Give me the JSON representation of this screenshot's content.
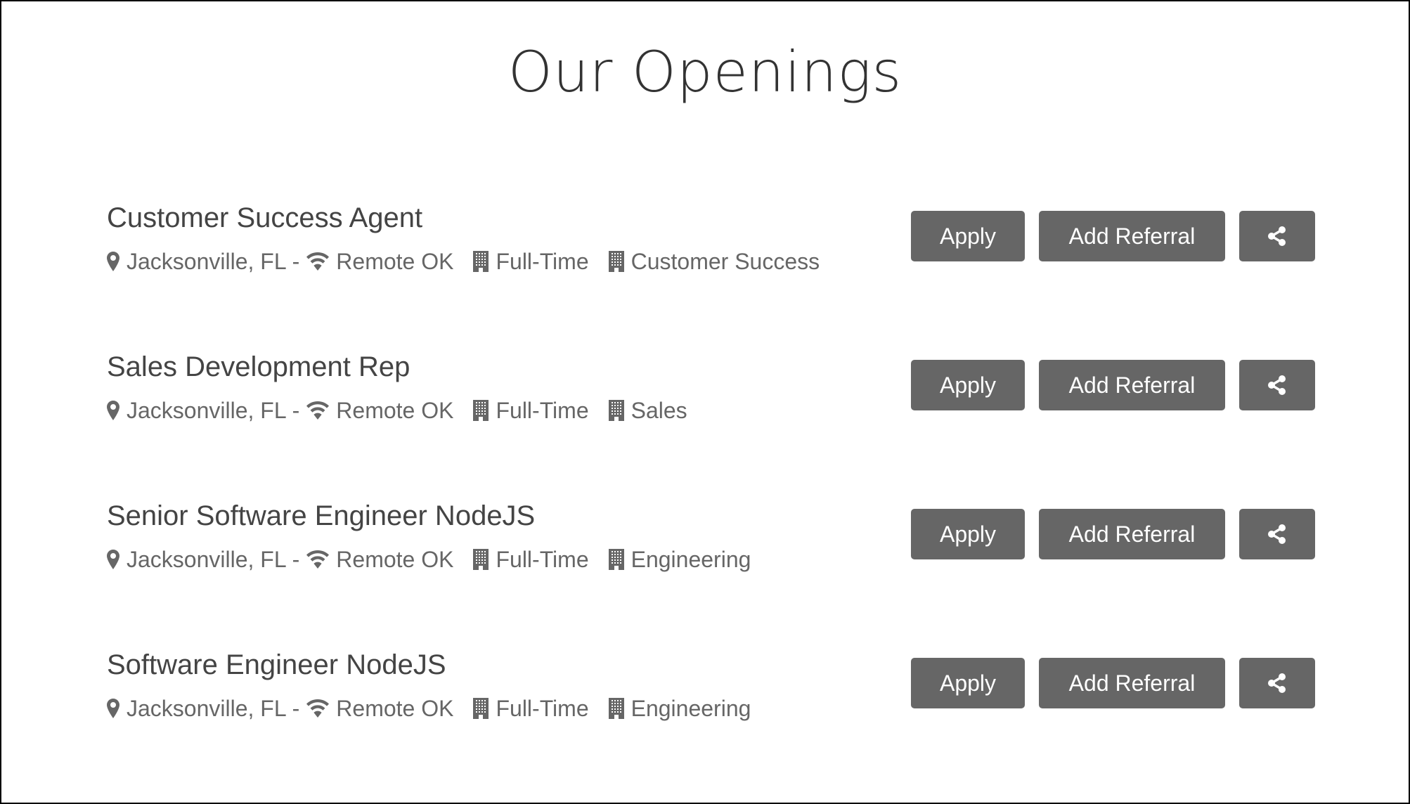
{
  "header": {
    "title": "Our Openings"
  },
  "buttons": {
    "apply_label": "Apply",
    "referral_label": "Add Referral",
    "share_icon": "share-icon"
  },
  "icons": {
    "location": "map-marker-icon",
    "remote": "wifi-icon",
    "type": "building-icon",
    "department": "building-icon"
  },
  "colors": {
    "button_bg": "#666666",
    "button_text": "#ffffff",
    "title_text": "#333333",
    "job_title_text": "#444444",
    "meta_text": "#666666"
  },
  "openings": [
    {
      "title": "Customer Success Agent",
      "location": "Jacksonville, FL",
      "separator": "-",
      "remote": "Remote OK",
      "type": "Full-Time",
      "department": "Customer Success"
    },
    {
      "title": "Sales Development Rep",
      "location": "Jacksonville, FL",
      "separator": "-",
      "remote": "Remote OK",
      "type": "Full-Time",
      "department": "Sales"
    },
    {
      "title": "Senior Software Engineer NodeJS",
      "location": "Jacksonville, FL",
      "separator": "-",
      "remote": "Remote OK",
      "type": "Full-Time",
      "department": "Engineering"
    },
    {
      "title": "Software Engineer NodeJS",
      "location": "Jacksonville, FL",
      "separator": "-",
      "remote": "Remote OK",
      "type": "Full-Time",
      "department": "Engineering"
    }
  ]
}
